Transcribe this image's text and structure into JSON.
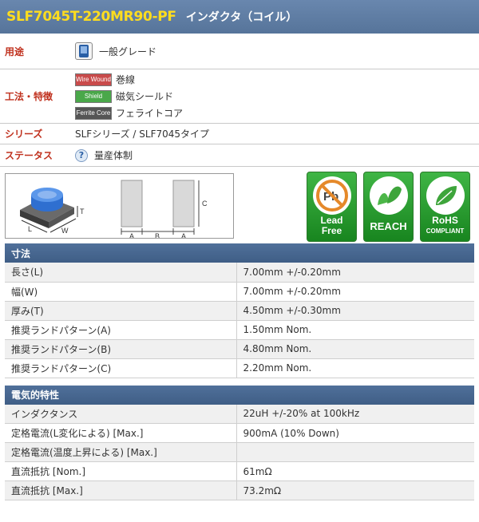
{
  "header": {
    "part_number": "SLF7045T-220MR90-PF",
    "category": "インダクタ（コイル）"
  },
  "attributes": {
    "usage": {
      "label": "用途",
      "value": "一般グレード",
      "icon": "device-phone-icon"
    },
    "method": {
      "label": "工法・特徴",
      "features": [
        {
          "badge": "Wire Wound",
          "badge_color": "#c94b4b",
          "text": "巻線"
        },
        {
          "badge": "Shield",
          "badge_color": "#4aa84a",
          "text": "磁気シールド"
        },
        {
          "badge": "Ferrite Core",
          "badge_color": "#555555",
          "text": "フェライトコア"
        }
      ]
    },
    "series": {
      "label": "シリーズ",
      "value": "SLFシリーズ / SLF7045タイプ"
    },
    "status": {
      "label": "ステータス",
      "value": "量産体制",
      "icon": "question-icon"
    }
  },
  "diagram": {
    "labels": {
      "a1": "A",
      "b": "B",
      "a2": "A",
      "c": "C",
      "t": "T",
      "l": "L",
      "w": "W"
    }
  },
  "certifications": [
    {
      "name": "lead-free",
      "label_line1": "Lead",
      "label_line2": "Free",
      "icon_text": "Pb"
    },
    {
      "name": "reach",
      "label_line1": "REACH",
      "label_line2": ""
    },
    {
      "name": "rohs",
      "label_line1": "RoHS",
      "label_line2": "COMPLIANT"
    }
  ],
  "dimensions": {
    "title": "寸法",
    "rows": [
      {
        "name": "長さ(L)",
        "value": "7.00mm +/-0.20mm"
      },
      {
        "name": "幅(W)",
        "value": "7.00mm +/-0.20mm"
      },
      {
        "name": "厚み(T)",
        "value": "4.50mm +/-0.30mm"
      },
      {
        "name": "推奨ランドパターン(A)",
        "value": "1.50mm Nom."
      },
      {
        "name": "推奨ランドパターン(B)",
        "value": "4.80mm Nom."
      },
      {
        "name": "推奨ランドパターン(C)",
        "value": "2.20mm Nom."
      }
    ]
  },
  "electrical": {
    "title": "電気的特性",
    "rows": [
      {
        "name": "インダクタンス",
        "value": "22uH +/-20% at 100kHz"
      },
      {
        "name": "定格電流(L変化による) [Max.]",
        "value": "900mA (10% Down)"
      },
      {
        "name": "定格電流(温度上昇による) [Max.]",
        "value": ""
      },
      {
        "name": "直流抵抗 [Nom.]",
        "value": "61mΩ"
      },
      {
        "name": "直流抵抗 [Max.]",
        "value": "73.2mΩ"
      }
    ]
  }
}
